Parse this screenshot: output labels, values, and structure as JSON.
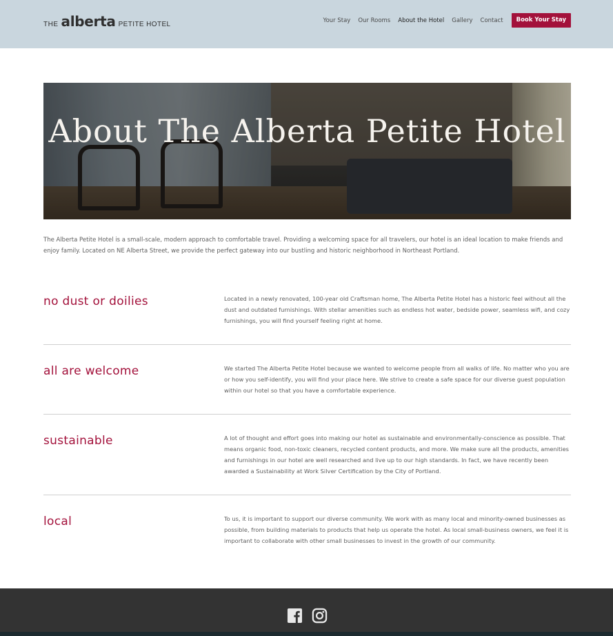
{
  "header": {
    "logo": {
      "the": "THE",
      "brand": "alberta",
      "rest": "PETITE HOTEL"
    },
    "nav": [
      {
        "label": "Your Stay"
      },
      {
        "label": "Our Rooms"
      },
      {
        "label": "About the Hotel",
        "active": true
      },
      {
        "label": "Gallery"
      },
      {
        "label": "Contact"
      }
    ],
    "book_label": "Book Your Stay"
  },
  "hero": {
    "title": "About The Alberta Petite Hotel"
  },
  "intro": "The Alberta Petite Hotel is a small-scale, modern approach to comfortable travel. Providing a welcoming space for all travelers, our hotel is an ideal location to make friends and enjoy family. Located on NE Alberta Street, we provide the perfect gateway into our bustling and historic neighborhood in Northeast Portland.",
  "features": [
    {
      "title": "no dust or doilies",
      "text": "Located in a newly renovated, 100-year old Craftsman home, The Alberta Petite Hotel has a historic feel without all the dust and outdated furnishings. With stellar amenities such as endless hot water, bedside power, seamless wifi, and cozy furnishings, you will find yourself feeling right at home."
    },
    {
      "title": "all are welcome",
      "text": "We started The Alberta Petite Hotel because we wanted to welcome people from all walks of life. No matter who you are or how you self-identify, you will find your place here. We strive to create a safe space for our diverse guest population within our hotel so that you have a comfortable experience."
    },
    {
      "title": "sustainable",
      "text": "A lot of thought and effort goes into making our hotel as sustainable and environmentally-conscience as possible. That means organic food, non-toxic cleaners, recycled content products, and more. We make sure all the products, amenities and furnishings in our hotel are well researched and live up to our high standards. In fact, we have recently been awarded a Sustainability at Work Silver Certification by the City of Portland."
    },
    {
      "title": "local",
      "text": "To us, it is important to support our diverse community. We work with as many local and minority-owned businesses as possible, from building materials to products that help us operate the hotel. As local small-business owners, we feel it is important to collaborate with other small businesses to invest in the growth of our community."
    }
  ],
  "footer": {
    "icons": [
      "facebook-icon",
      "instagram-icon"
    ]
  },
  "colors": {
    "header_bg": "#c9d6de",
    "accent": "#a3113b",
    "footer_bg": "#333333"
  }
}
